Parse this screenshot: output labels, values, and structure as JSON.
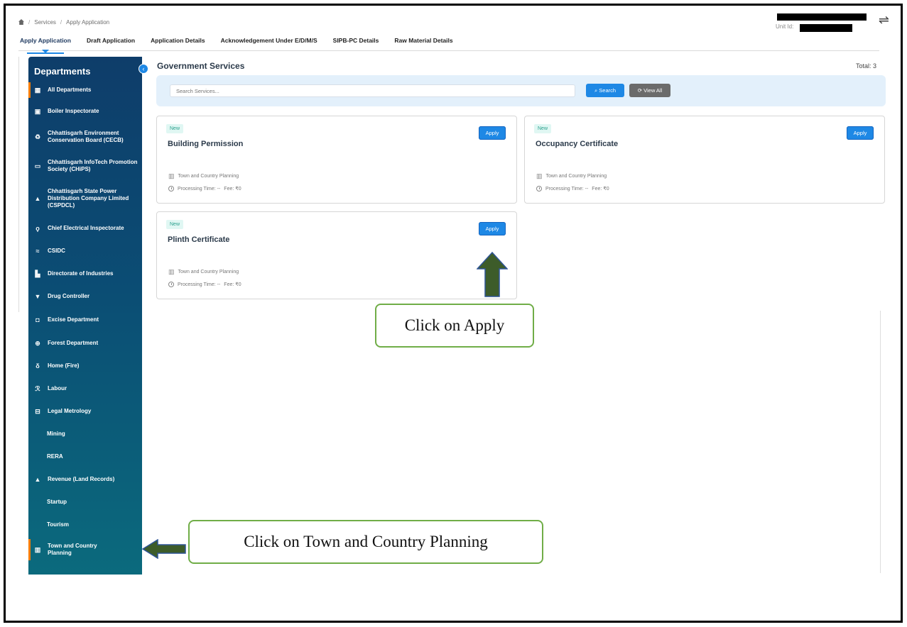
{
  "breadcrumb": {
    "items": [
      "Services",
      "Apply Application"
    ],
    "sep": "/"
  },
  "header": {
    "unit_label": "Unit Id:"
  },
  "tabs": [
    {
      "label": "Apply Application"
    },
    {
      "label": "Draft Application"
    },
    {
      "label": "Application Details"
    },
    {
      "label": "Acknowledgement Under E/D/M/S"
    },
    {
      "label": "SIPB-PC Details"
    },
    {
      "label": "Raw Material Details"
    }
  ],
  "sidebar": {
    "title": "Departments",
    "items": [
      {
        "label": "All Departments",
        "icon": "grid-icon"
      },
      {
        "label": "Boiler Inspectorate",
        "icon": "boiler-icon"
      },
      {
        "label": "Chhattisgarh Environment Conservation Board (CECB)",
        "icon": "recycle-icon"
      },
      {
        "label": "Chhattisgarh InfoTech Promotion Society (CHiPS)",
        "icon": "chip-icon"
      },
      {
        "label": "Chhattisgarh State Power Distribution Company Limited (CSPDCL)",
        "icon": "power-icon"
      },
      {
        "label": "Chief Electrical Inspectorate",
        "icon": "plug-icon"
      },
      {
        "label": "CSIDC",
        "icon": "waves-icon"
      },
      {
        "label": "Directorate of Industries",
        "icon": "factory-icon"
      },
      {
        "label": "Drug Controller",
        "icon": "pill-icon"
      },
      {
        "label": "Excise Department",
        "icon": "bottle-icon"
      },
      {
        "label": "Forest Department",
        "icon": "tree-icon"
      },
      {
        "label": "Home (Fire)",
        "icon": "fire-icon"
      },
      {
        "label": "Labour",
        "icon": "worker-icon"
      },
      {
        "label": "Legal Metrology",
        "icon": "scale-icon"
      },
      {
        "label": "Mining",
        "icon": ""
      },
      {
        "label": "RERA",
        "icon": ""
      },
      {
        "label": "Revenue (Land Records)",
        "icon": "land-icon"
      },
      {
        "label": "Startup",
        "icon": ""
      },
      {
        "label": "Tourism",
        "icon": ""
      },
      {
        "label": "Town and Country Planning",
        "icon": "building-icon"
      }
    ]
  },
  "main": {
    "title": "Government Services",
    "total": "Total: 3",
    "search_placeholder": "Search Services...",
    "search_label": "Search",
    "view_all_label": "View All",
    "cards": [
      {
        "badge": "New",
        "title": "Building Permission",
        "apply": "Apply",
        "department": "Town and Country Planning",
        "processing": "Processing Time: --",
        "fee": "Fee: ₹0"
      },
      {
        "badge": "New",
        "title": "Occupancy Certificate",
        "apply": "Apply",
        "department": "Town and Country Planning",
        "processing": "Processing Time: --",
        "fee": "Fee: ₹0"
      },
      {
        "badge": "New",
        "title": "Plinth Certificate",
        "apply": "Apply",
        "department": "Town and Country Planning",
        "processing": "Processing Time: --",
        "fee": "Fee: ₹0"
      }
    ]
  },
  "annotations": {
    "apply_callout": "Click on Apply",
    "tcp_callout": "Click on Town and Country Planning"
  },
  "colors": {
    "sidebar_top": "#0e3d6a",
    "sidebar_bottom": "#0b6a7d",
    "accent": "#1e88e5",
    "active_marker": "#f57c00",
    "callout_border": "#70ad47",
    "arrow_fill": "#3d5c2a"
  }
}
